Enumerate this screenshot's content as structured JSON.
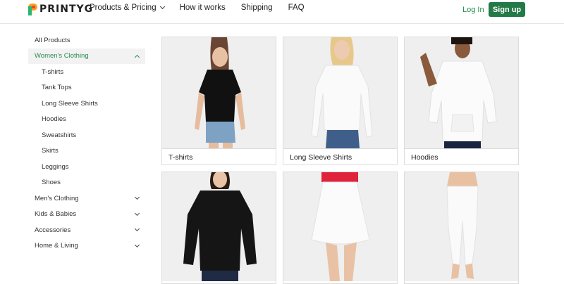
{
  "brand": {
    "name": "PRINTYG"
  },
  "nav": {
    "items": [
      {
        "label": "Products & Pricing",
        "has_dropdown": true
      },
      {
        "label": "How it works",
        "has_dropdown": false
      },
      {
        "label": "Shipping",
        "has_dropdown": false
      },
      {
        "label": "FAQ",
        "has_dropdown": false
      }
    ],
    "login": "Log In",
    "signup": "Sign up"
  },
  "sidebar": {
    "items": [
      {
        "label": "All Products",
        "level": 0,
        "chevron": "none"
      },
      {
        "label": "Women's Clothing",
        "level": 0,
        "chevron": "up",
        "active": true
      },
      {
        "label": "T-shirts",
        "level": 1
      },
      {
        "label": "Tank Tops",
        "level": 1
      },
      {
        "label": "Long Sleeve Shirts",
        "level": 1
      },
      {
        "label": "Hoodies",
        "level": 1
      },
      {
        "label": "Sweatshirts",
        "level": 1
      },
      {
        "label": "Skirts",
        "level": 1
      },
      {
        "label": "Leggings",
        "level": 1
      },
      {
        "label": "Shoes",
        "level": 1
      },
      {
        "label": "Men's Clothing",
        "level": 0,
        "chevron": "down"
      },
      {
        "label": "Kids & Babies",
        "level": 0,
        "chevron": "down"
      },
      {
        "label": "Accessories",
        "level": 0,
        "chevron": "down"
      },
      {
        "label": "Home & Living",
        "level": 0,
        "chevron": "down"
      }
    ]
  },
  "products": [
    {
      "title": "T-shirts",
      "icon": "black-tshirt-model"
    },
    {
      "title": "Long Sleeve Shirts",
      "icon": "white-long-sleeve-model"
    },
    {
      "title": "Hoodies",
      "icon": "white-hoodie-model"
    },
    {
      "title": "",
      "icon": "black-sweatshirt-model"
    },
    {
      "title": "",
      "icon": "white-skirt-model"
    },
    {
      "title": "",
      "icon": "white-leggings-model"
    }
  ],
  "colors": {
    "accent": "#237a47",
    "accent_text": "#2a8a50",
    "logo_orange": "#f4a51c",
    "logo_green": "#2bb673",
    "logo_red": "#e8413f"
  }
}
